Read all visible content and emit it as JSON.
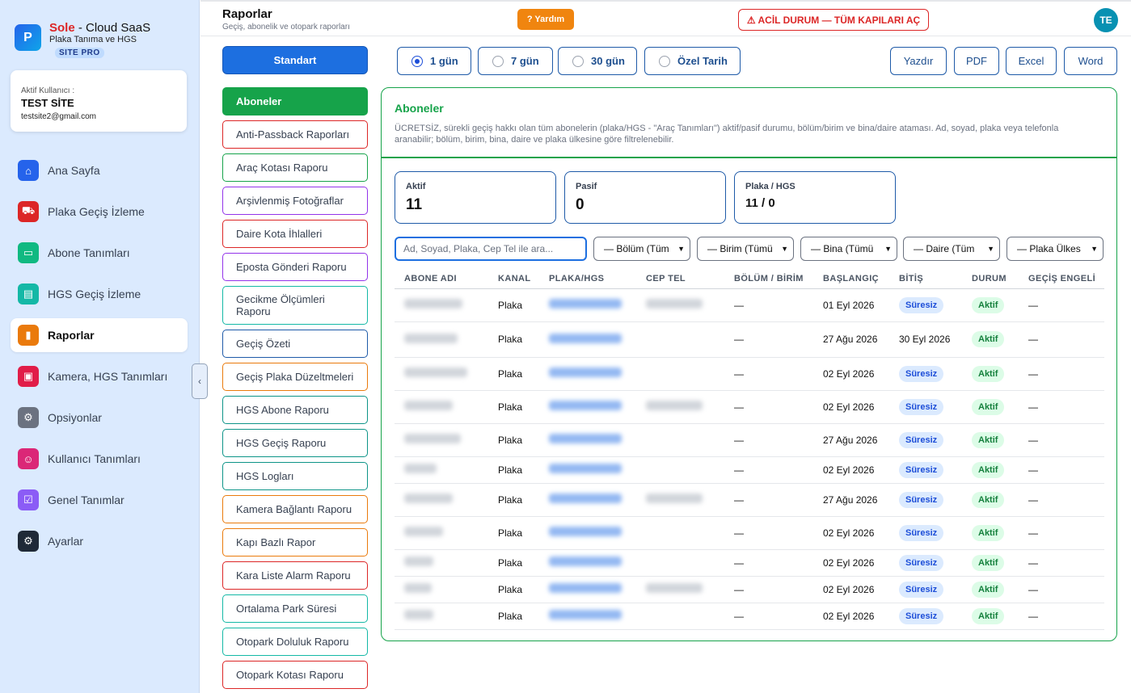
{
  "brand": {
    "logo": "P",
    "name": "Sole",
    "suffix": " - Cloud SaaS",
    "subtitle": "Plaka Tanıma ve HGS",
    "badge": "SITE PRO"
  },
  "user": {
    "label": "Aktif Kullanıcı :",
    "name": "TEST SİTE",
    "email": "testsite2@gmail.com"
  },
  "nav": [
    {
      "label": "Ana Sayfa",
      "icon": "home-icon",
      "color": "#2563eb"
    },
    {
      "label": "Plaka Geçiş İzleme",
      "icon": "car-icon",
      "color": "#dc2626"
    },
    {
      "label": "Abone Tanımları",
      "icon": "car-front-icon",
      "color": "#10b981"
    },
    {
      "label": "HGS Geçiş İzleme",
      "icon": "card-icon",
      "color": "#14b8a6"
    },
    {
      "label": "Raporlar",
      "icon": "chart-icon",
      "color": "#ea7a0c"
    },
    {
      "label": "Kamera, HGS Tanımları",
      "icon": "chip-icon",
      "color": "#e11d48"
    },
    {
      "label": "Opsiyonlar",
      "icon": "gear-icon",
      "color": "#6b7280"
    },
    {
      "label": "Kullanıcı Tanımları",
      "icon": "users-icon",
      "color": "#db2777"
    },
    {
      "label": "Genel Tanımlar",
      "icon": "check-square-icon",
      "color": "#8b5cf6"
    },
    {
      "label": "Ayarlar",
      "icon": "settings-icon",
      "color": "#1f2937"
    }
  ],
  "header": {
    "title": "Raporlar",
    "subtitle": "Geçiş, abonelik ve otopark raporları",
    "help": "? Yardım",
    "emergency": "⚠ ACİL DURUM — TÜM KAPILARI AÇ",
    "avatar": "TE"
  },
  "standard": "Standart",
  "reports": [
    {
      "label": "Aboneler",
      "color": "#16a34a"
    },
    {
      "label": "Anti-Passback Raporları",
      "color": "#dc2626"
    },
    {
      "label": "Araç Kotası Raporu",
      "color": "#16a34a"
    },
    {
      "label": "Arşivlenmiş Fotoğraflar",
      "color": "#9333ea"
    },
    {
      "label": "Daire Kota İhlalleri",
      "color": "#dc2626"
    },
    {
      "label": "Eposta Gönderi Raporu",
      "color": "#9333ea"
    },
    {
      "label": "Gecikme Ölçümleri Raporu",
      "color": "#14b8a6"
    },
    {
      "label": "Geçiş Özeti",
      "color": "#1e5aa8"
    },
    {
      "label": "Geçiş Plaka Düzeltmeleri",
      "color": "#ea7a0c"
    },
    {
      "label": "HGS Abone Raporu",
      "color": "#0d9488"
    },
    {
      "label": "HGS Geçiş Raporu",
      "color": "#0d9488"
    },
    {
      "label": "HGS Logları",
      "color": "#0d9488"
    },
    {
      "label": "Kamera Bağlantı Raporu",
      "color": "#ea7a0c"
    },
    {
      "label": "Kapı Bazlı Rapor",
      "color": "#ea7a0c"
    },
    {
      "label": "Kara Liste Alarm Raporu",
      "color": "#dc2626"
    },
    {
      "label": "Ortalama Park Süresi",
      "color": "#14b8a6"
    },
    {
      "label": "Otopark Doluluk Raporu",
      "color": "#14b8a6"
    },
    {
      "label": "Otopark Kotası Raporu",
      "color": "#dc2626"
    }
  ],
  "ranges": [
    {
      "label": "1 gün",
      "selected": true
    },
    {
      "label": "7 gün",
      "selected": false
    },
    {
      "label": "30 gün",
      "selected": false
    },
    {
      "label": "Özel Tarih",
      "selected": false
    }
  ],
  "exports": [
    "Yazdır",
    "PDF",
    "Excel",
    "Word"
  ],
  "panel": {
    "title": "Aboneler",
    "description": "ÜCRETSİZ, sürekli geçiş hakkı olan tüm abonelerin (plaka/HGS - \"Araç Tanımları\") aktif/pasif durumu, bölüm/birim ve bina/daire ataması. Ad, soyad, plaka veya telefonla aranabilir; bölüm, birim, bina, daire ve plaka ülkesine göre filtrelenebilir."
  },
  "stats": [
    {
      "label": "Aktif",
      "value": "11"
    },
    {
      "label": "Pasif",
      "value": "0"
    },
    {
      "label": "Plaka / HGS",
      "value": "11 / 0"
    }
  ],
  "search_placeholder": "Ad, Soyad, Plaka, Cep Tel ile ara...",
  "filters": [
    "— Bölüm (Tüm",
    "— Birim (Tümü",
    "— Bina (Tümü",
    "— Daire (Tüm",
    "— Plaka Ülkes"
  ],
  "columns": [
    "ABONE ADI",
    "KANAL",
    "PLAKA/HGS",
    "CEP TEL",
    "BÖLÜM / BİRİM",
    "BAŞLANGIÇ",
    "BİTİŞ",
    "DURUM",
    "GEÇİŞ ENGELİ"
  ],
  "rows": [
    {
      "kanal": "Plaka",
      "bolum": "—",
      "baslangic": "01 Eyl 2026",
      "bitis": "Süresiz",
      "durum": "Aktif",
      "engel": "—"
    },
    {
      "kanal": "Plaka",
      "bolum": "—",
      "baslangic": "27 Ağu 2026",
      "bitis": "30 Eyl 2026",
      "durum": "Aktif",
      "engel": "—"
    },
    {
      "kanal": "Plaka",
      "bolum": "—",
      "baslangic": "02 Eyl 2026",
      "bitis": "Süresiz",
      "durum": "Aktif",
      "engel": "—"
    },
    {
      "kanal": "Plaka",
      "bolum": "—",
      "baslangic": "02 Eyl 2026",
      "bitis": "Süresiz",
      "durum": "Aktif",
      "engel": "—"
    },
    {
      "kanal": "Plaka",
      "bolum": "—",
      "baslangic": "27 Ağu 2026",
      "bitis": "Süresiz",
      "durum": "Aktif",
      "engel": "—"
    },
    {
      "kanal": "Plaka",
      "bolum": "—",
      "baslangic": "02 Eyl 2026",
      "bitis": "Süresiz",
      "durum": "Aktif",
      "engel": "—"
    },
    {
      "kanal": "Plaka",
      "bolum": "—",
      "baslangic": "27 Ağu 2026",
      "bitis": "Süresiz",
      "durum": "Aktif",
      "engel": "—"
    },
    {
      "kanal": "Plaka",
      "bolum": "—",
      "baslangic": "02 Eyl 2026",
      "bitis": "Süresiz",
      "durum": "Aktif",
      "engel": "—"
    },
    {
      "kanal": "Plaka",
      "bolum": "—",
      "baslangic": "02 Eyl 2026",
      "bitis": "Süresiz",
      "durum": "Aktif",
      "engel": "—"
    },
    {
      "kanal": "Plaka",
      "bolum": "—",
      "baslangic": "02 Eyl 2026",
      "bitis": "Süresiz",
      "durum": "Aktif",
      "engel": "—"
    },
    {
      "kanal": "Plaka",
      "bolum": "—",
      "baslangic": "02 Eyl 2026",
      "bitis": "Süresiz",
      "durum": "Aktif",
      "engel": "—"
    }
  ]
}
